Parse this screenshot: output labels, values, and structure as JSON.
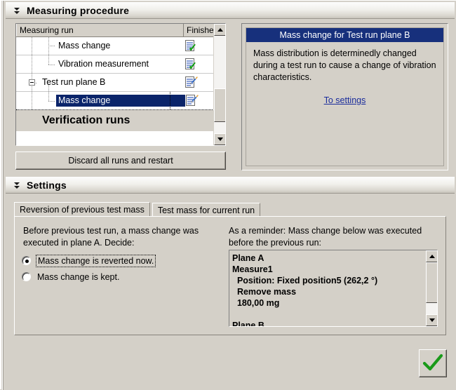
{
  "window": {
    "background": "#d4d0c8"
  },
  "sections": {
    "measuring": {
      "title": "Measuring procedure",
      "collapse_icon": "chevron-double-down-icon"
    },
    "settings": {
      "title": "Settings",
      "collapse_icon": "chevron-double-down-icon"
    }
  },
  "tree": {
    "columns": [
      "Measuring run",
      "Finished"
    ],
    "rows": [
      {
        "label": "Mass change",
        "indent": 2,
        "icon": "document-check-icon",
        "selected": false,
        "expander": false
      },
      {
        "label": "Vibration measurement",
        "indent": 2,
        "icon": "document-check-icon",
        "selected": false,
        "expander": false
      },
      {
        "label": "Test run plane B",
        "indent": 1,
        "icon": "document-pencil-icon",
        "selected": false,
        "expander": true
      },
      {
        "label": "Mass change",
        "indent": 2,
        "icon": "document-pencil-icon",
        "selected": true,
        "expander": false
      },
      {
        "label": "Verification runs",
        "indent": 1,
        "icon": "",
        "selected": false,
        "expander": false
      }
    ],
    "scrollbar": {
      "up_icon": "scroll-up-arrow-icon",
      "down_icon": "scroll-down-arrow-icon"
    }
  },
  "buttons": {
    "discard": "Discard all runs and restart",
    "ok_icon": "green-check-icon"
  },
  "info_panel": {
    "title": "Mass change for Test run plane B",
    "body": "Mass distribution is determinedly changed during a test run to cause a change of vibration characteristics.",
    "link": "To settings",
    "title_bg": "#17307c",
    "link_color": "#1a2c9b"
  },
  "settings_panel": {
    "tabs": [
      {
        "label": "Reversion of previous test mass",
        "active": true
      },
      {
        "label": "Test mass for current run",
        "active": false
      }
    ],
    "left": {
      "prompt": "Before previous test run, a mass change was executed in plane A. Decide:",
      "options": [
        {
          "label": "Mass change is reverted now.",
          "selected": true
        },
        {
          "label": "Mass change is kept.",
          "selected": false
        }
      ]
    },
    "right": {
      "prompt": "As a reminder: Mass change below was executed before the previous run:",
      "listbox_text": "Plane A\nMeasure1\n  Position: Fixed position5 (262,2 °)\n  Remove mass\n  180,00 mg\n\nPlane B",
      "scrollbar": {
        "up_icon": "scroll-up-arrow-icon",
        "down_icon": "scroll-down-arrow-icon"
      }
    }
  }
}
